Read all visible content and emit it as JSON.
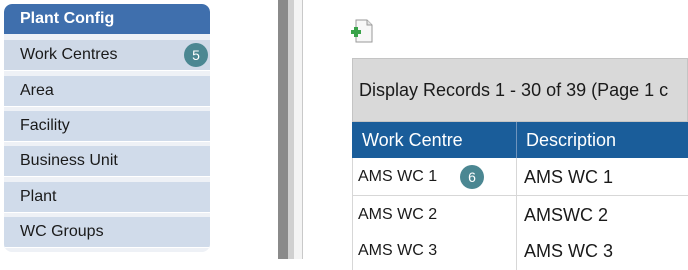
{
  "sidebar": {
    "title": "Plant Config",
    "items": [
      {
        "label": "Work Centres",
        "badge": "5"
      },
      {
        "label": "Area"
      },
      {
        "label": "Facility"
      },
      {
        "label": "Business Unit"
      },
      {
        "label": "Plant"
      },
      {
        "label": "WC Groups"
      }
    ]
  },
  "toolbar": {
    "new_icon": "new-document-icon"
  },
  "grid": {
    "records_text": "Display Records 1 - 30 of 39 (Page 1 c",
    "columns": [
      "Work Centre",
      "Description"
    ],
    "rows": [
      {
        "work_centre": "AMS WC 1",
        "description": "AMS WC 1",
        "badge": "6"
      },
      {
        "work_centre": "AMS WC 2",
        "description": "AMSWC 2"
      },
      {
        "work_centre": "AMS WC 3",
        "description": "AMS WC 3"
      }
    ]
  },
  "colors": {
    "sidebar_header": "#3f6fad",
    "sidebar_item": "#d0dbea",
    "grid_header": "#1a5d9a",
    "badge": "#4b8792"
  }
}
